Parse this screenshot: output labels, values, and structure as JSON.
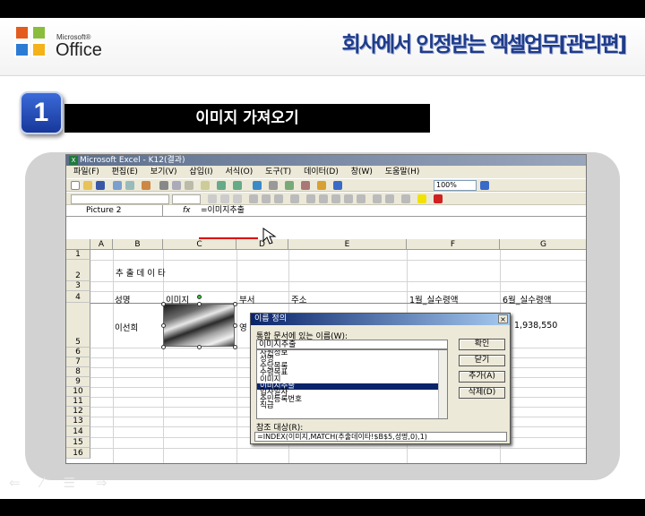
{
  "header": {
    "brand_small": "Microsoft®",
    "brand": "Office",
    "title": "회사에서 인정받는 엑셀업무[관리편]"
  },
  "section": {
    "number": "1",
    "title": "이미지 가져오기"
  },
  "excel": {
    "window_title": "Microsoft Excel - K12(결과)",
    "menu": [
      "파일(F)",
      "편집(E)",
      "보기(V)",
      "삽입(I)",
      "서식(O)",
      "도구(T)",
      "데이터(D)",
      "창(W)",
      "도움말(H)"
    ],
    "zoom": "100%",
    "name_box": "Picture 2",
    "fx": "fx",
    "formula": "=이미지추출",
    "columns": [
      "A",
      "B",
      "C",
      "D",
      "E",
      "F",
      "G"
    ],
    "rows": [
      "1",
      "2",
      "3",
      "4",
      "5",
      "6",
      "7",
      "8",
      "9",
      "10",
      "11",
      "12",
      "13",
      "14",
      "15",
      "16"
    ],
    "cells": {
      "title": "추 출 데 이 타",
      "h_name": "성명",
      "h_image": "이미지",
      "h_dept": "부서",
      "h_addr": "주소",
      "h_jan": "1월_실수령액",
      "h_jun": "6월_실수령액",
      "name": "이선희",
      "dept_partial": "영",
      "jun_value": "1,938,550"
    }
  },
  "dialog": {
    "title": "이름 정의",
    "close": "×",
    "label_names": "통합 문서에 있는 이름(W):",
    "name_value": "이미지추출",
    "list": [
      "사원정보",
      "성명",
      "수당목록",
      "수령목표",
      "이미지",
      "이미지추출",
      "입사일자",
      "주민등록번호",
      "직급"
    ],
    "selected_index": 5,
    "btn_ok": "확인",
    "btn_close": "닫기",
    "btn_add": "추가(A)",
    "btn_delete": "삭제(D)",
    "label_ref": "참조 대상(R):",
    "ref_value": "=INDEX(이미지,MATCH(추출데이타!$B$5,성명,0),1)"
  },
  "nav": "⇐ ⁄ ☰ ⇒",
  "colors": {
    "accent": "#1f3c8a",
    "titlebar": "#0a246a",
    "selection": "#0a246a"
  }
}
